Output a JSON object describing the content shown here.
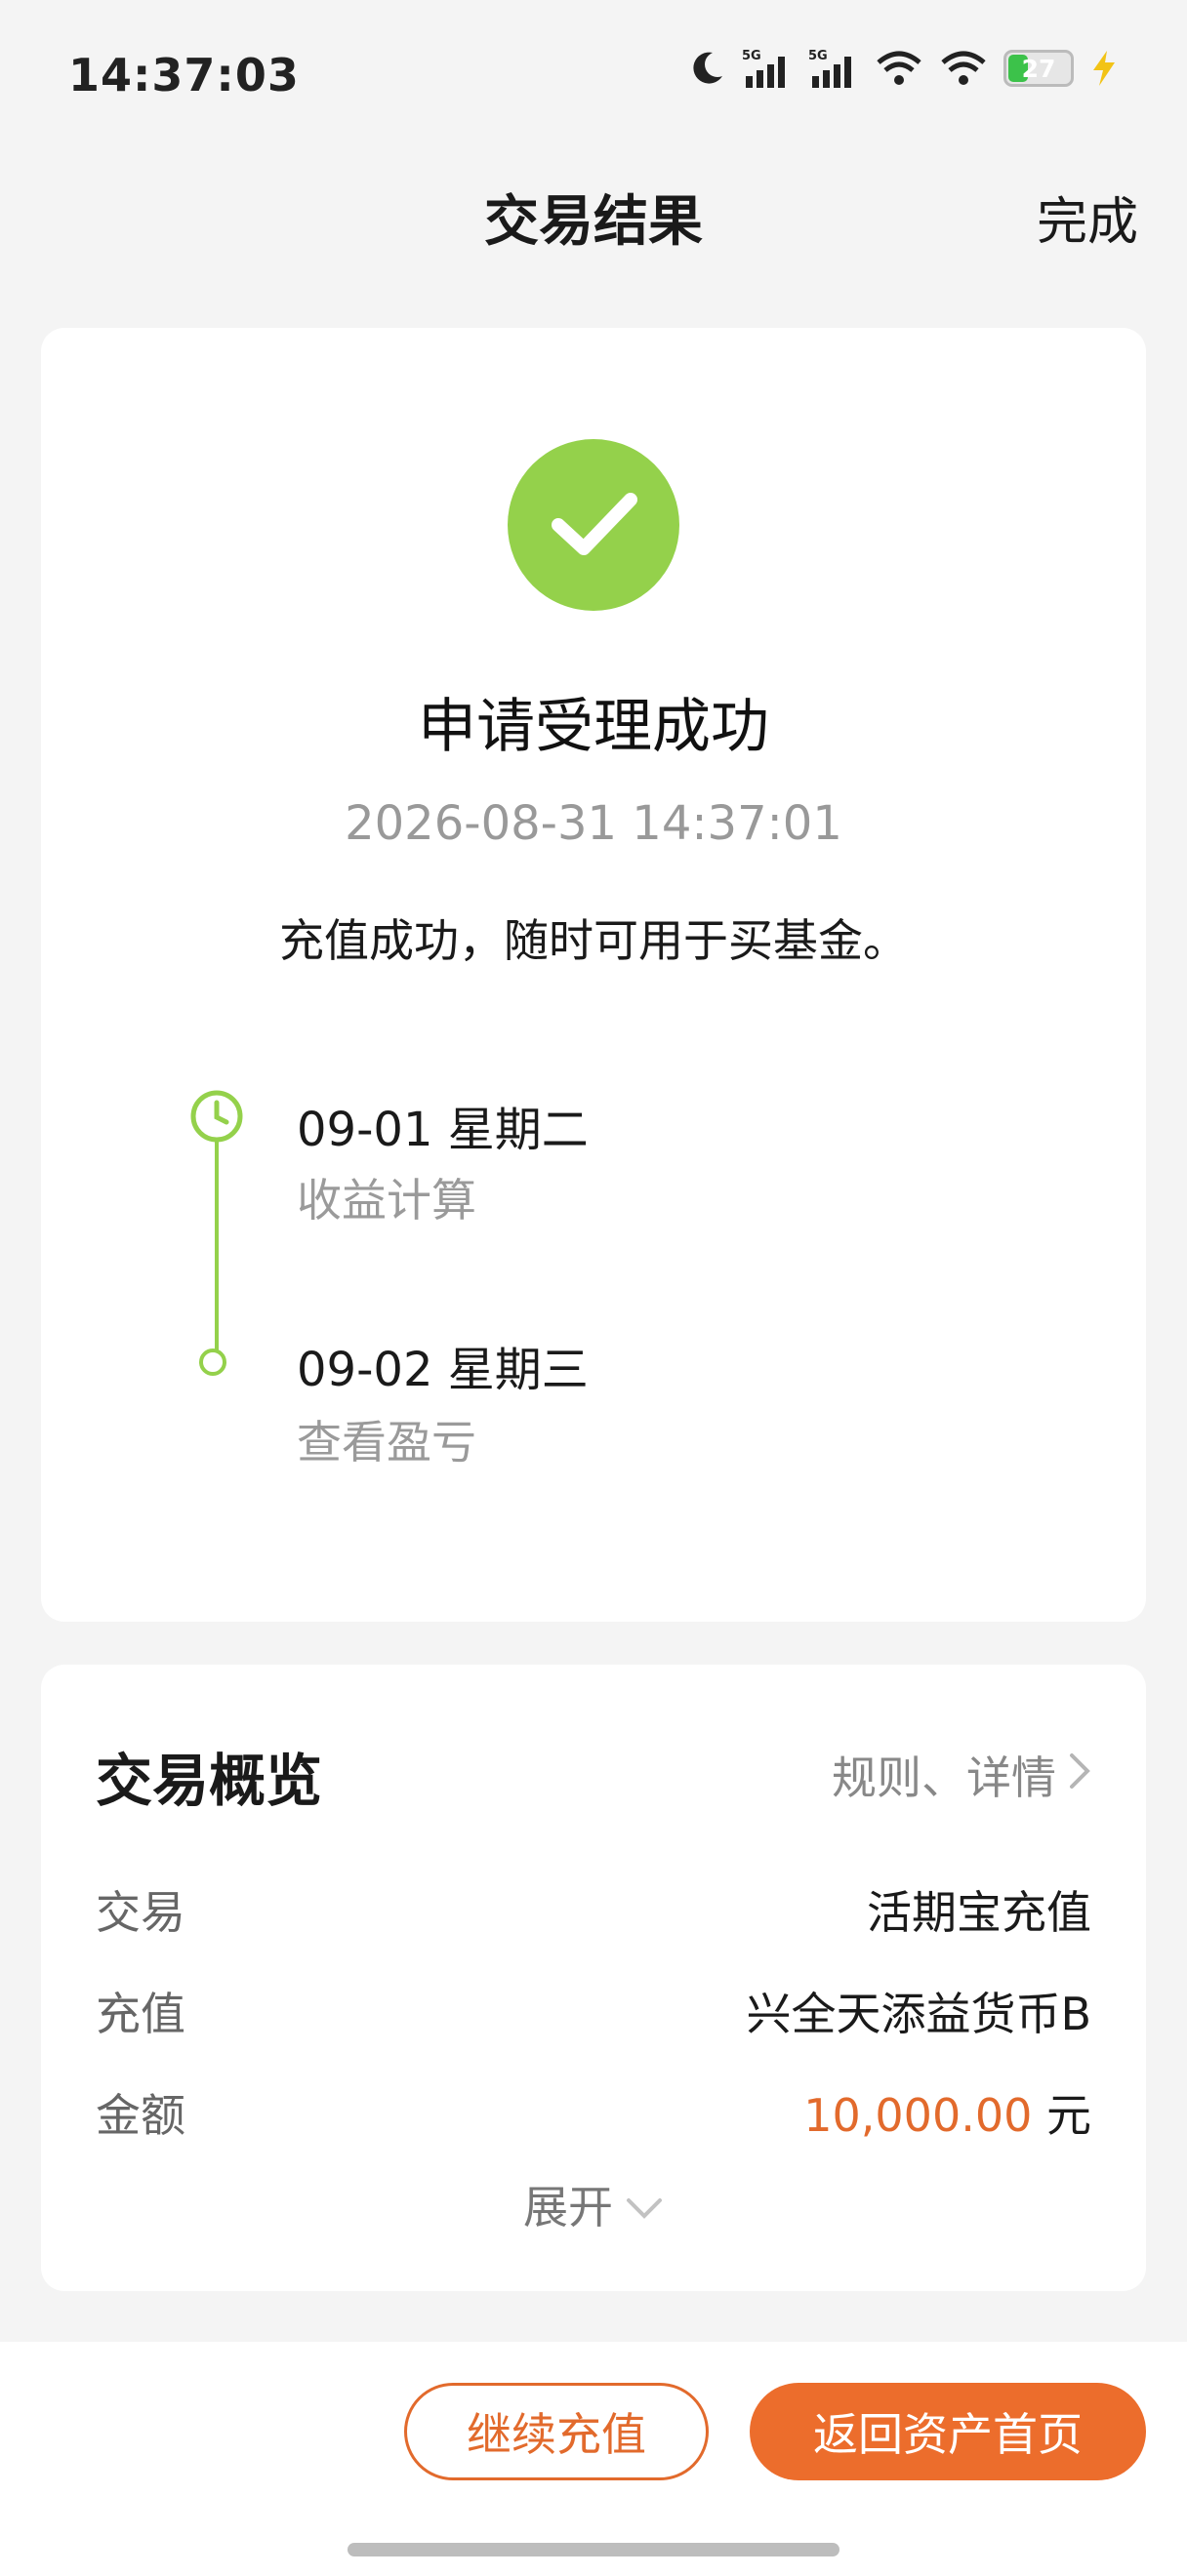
{
  "status_bar": {
    "time": "14:37:03",
    "battery_level": "27",
    "icons": [
      "moon-icon",
      "signal-5g-icon",
      "signal-5g-icon",
      "wifi-icon",
      "wifi-icon",
      "battery-icon",
      "charging-icon"
    ],
    "signal_label": "5G"
  },
  "header": {
    "title": "交易结果",
    "done_label": "完成"
  },
  "result": {
    "status_icon": "check-icon",
    "title": "申请受理成功",
    "timestamp": "2026-08-31 14:37:01",
    "description": "充值成功，随时可用于买基金。",
    "timeline": [
      {
        "date": "09-01  星期二",
        "label": "收益计算"
      },
      {
        "date": "09-02  星期三",
        "label": "查看盈亏"
      }
    ]
  },
  "overview": {
    "title": "交易概览",
    "link_label": "规则、详情",
    "rows": [
      {
        "label": "交易",
        "value": "活期宝充值"
      },
      {
        "label": "充值",
        "value": "兴全天添益货币B"
      },
      {
        "label": "金额",
        "amount": "10,000.00",
        "unit": "元"
      }
    ],
    "expand_label": "展开"
  },
  "actions": {
    "continue_label": "继续充值",
    "home_label": "返回资产首页"
  },
  "colors": {
    "accent": "#ec6d2c",
    "success": "#94d14b",
    "amount": "#e26a2c"
  }
}
